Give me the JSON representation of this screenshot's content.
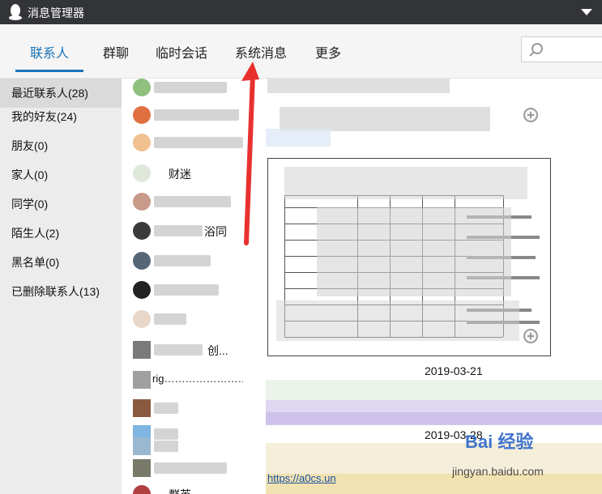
{
  "window": {
    "title": "消息管理器"
  },
  "tabs": [
    {
      "label": "联系人",
      "active": true
    },
    {
      "label": "群聊",
      "active": false
    },
    {
      "label": "临时会话",
      "active": false
    },
    {
      "label": "系统消息",
      "active": false
    },
    {
      "label": "更多",
      "active": false
    }
  ],
  "search": {
    "placeholder": ""
  },
  "categories": [
    {
      "label": "最近联系人(28)",
      "active": true
    },
    {
      "label": "我的好友(24)",
      "active": false
    },
    {
      "label": "朋友(0)",
      "active": false
    },
    {
      "label": "家人(0)",
      "active": false
    },
    {
      "label": "同学(0)",
      "active": false
    },
    {
      "label": "陌生人(2)",
      "active": false
    },
    {
      "label": "黑名单(0)",
      "active": false
    },
    {
      "label": "已删除联系人(13)",
      "active": false
    }
  ],
  "contacts": [
    {
      "name": ""
    },
    {
      "name": ""
    },
    {
      "name": ""
    },
    {
      "name": "财迷"
    },
    {
      "name": ""
    },
    {
      "name": "浴同"
    },
    {
      "name": ""
    },
    {
      "name": ""
    },
    {
      "name": ""
    },
    {
      "name": "创..."
    },
    {
      "name": "rig……………………@•ôõ•"
    },
    {
      "name": ""
    },
    {
      "name": ""
    },
    {
      "name": ""
    },
    {
      "name": ""
    },
    {
      "name": "群英"
    }
  ],
  "messages": {
    "date_1": "2019-03-21",
    "date_2": "2019-03-28",
    "link_text": "https://a0cs.un",
    "watermark": "Bai 经验",
    "watermark_sub": "jingyan.baidu.com"
  },
  "colors": {
    "titlebar": "#333438",
    "accent": "#1a73b8",
    "arrow": "#e8312f",
    "sidebar": "#ececec"
  }
}
